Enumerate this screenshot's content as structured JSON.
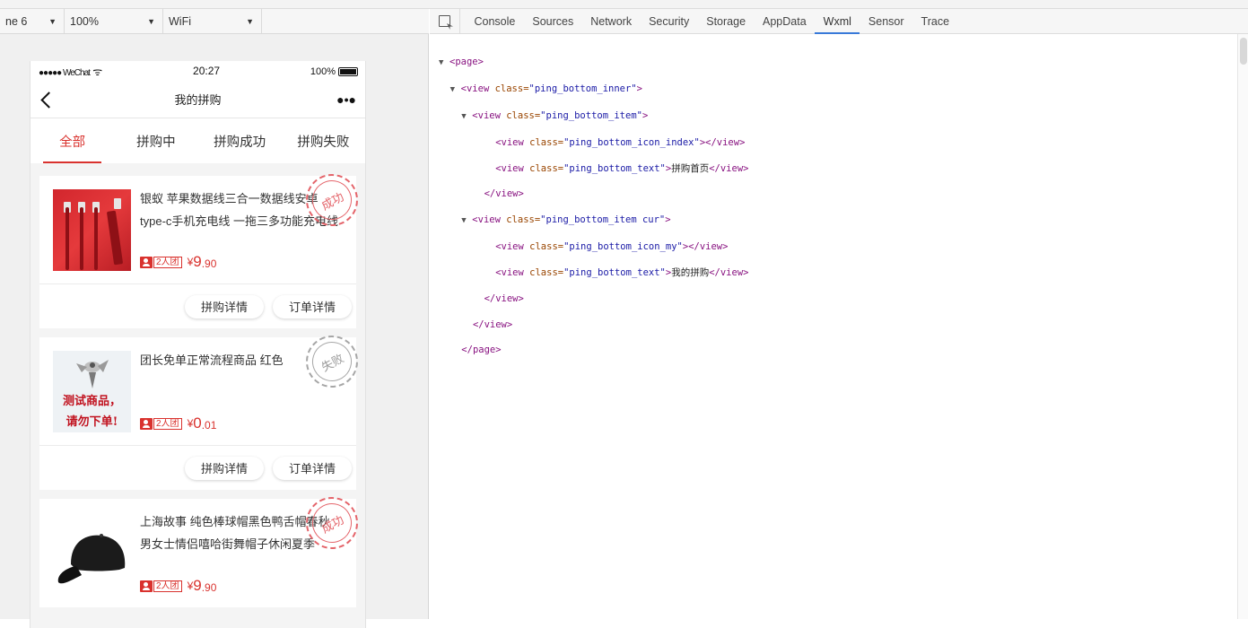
{
  "device_bar": {
    "device": "ne 6",
    "zoom": "100%",
    "network": "WiFi"
  },
  "phone": {
    "status": {
      "carrier": "●●●●● WeChat",
      "time": "20:27",
      "battery": "100%"
    },
    "nav_title": "我的拼购",
    "tabs": [
      {
        "label": "全部",
        "active": true
      },
      {
        "label": "拼购中",
        "active": false
      },
      {
        "label": "拼购成功",
        "active": false
      },
      {
        "label": "拼购失败",
        "active": false
      }
    ],
    "orders": [
      {
        "name": "银蚁 苹果数据线三合一数据线安卓type-c手机充电线 一拖三多功能充电线",
        "group": "2人团",
        "yen": "¥",
        "price_int": "9",
        "price_dec": ".90",
        "stamp": "成功",
        "stamp_state": "success",
        "btn_detail": "拼购详情",
        "btn_order": "订单详情"
      },
      {
        "name": "团长免单正常流程商品 红色",
        "group": "2人团",
        "yen": "¥",
        "price_int": "0",
        "price_dec": ".01",
        "stamp": "失败",
        "stamp_state": "fail",
        "thumb_text_1": "测试商品，",
        "thumb_text_2": "请勿下单!",
        "btn_detail": "拼购详情",
        "btn_order": "订单详情"
      },
      {
        "name": "上海故事 纯色棒球帽黑色鸭舌帽春秋男女士情侣嘻哈街舞帽子休闲夏季",
        "group": "2人团",
        "yen": "¥",
        "price_int": "9",
        "price_dec": ".90",
        "stamp": "成功",
        "stamp_state": "success"
      }
    ]
  },
  "devtools": {
    "tabs": [
      "Console",
      "Sources",
      "Network",
      "Security",
      "Storage",
      "AppData",
      "Wxml",
      "Sensor",
      "Trace"
    ],
    "active_tab": "Wxml",
    "wxml": {
      "page_open": "<page>",
      "inner_open_tag": "<view",
      "class_attr": "class=",
      "inner_class": "\"ping_bottom_inner\"",
      "item_class": "\"ping_bottom_item\"",
      "icon_index_class": "\"ping_bottom_icon_index\"",
      "text_class": "\"ping_bottom_text\"",
      "item_cur_class": "\"ping_bottom_item cur\"",
      "icon_my_class": "\"ping_bottom_icon_my\"",
      "text_home": "拼购首页",
      "text_my": "我的拼购",
      "close_view": "</view>",
      "page_close": "</page>"
    }
  },
  "colors": {
    "accent_red": "#d9322e",
    "stamp_success": "#e4646a",
    "stamp_fail": "#9a9a9a",
    "devtools_tab_underline": "#3879d9"
  }
}
